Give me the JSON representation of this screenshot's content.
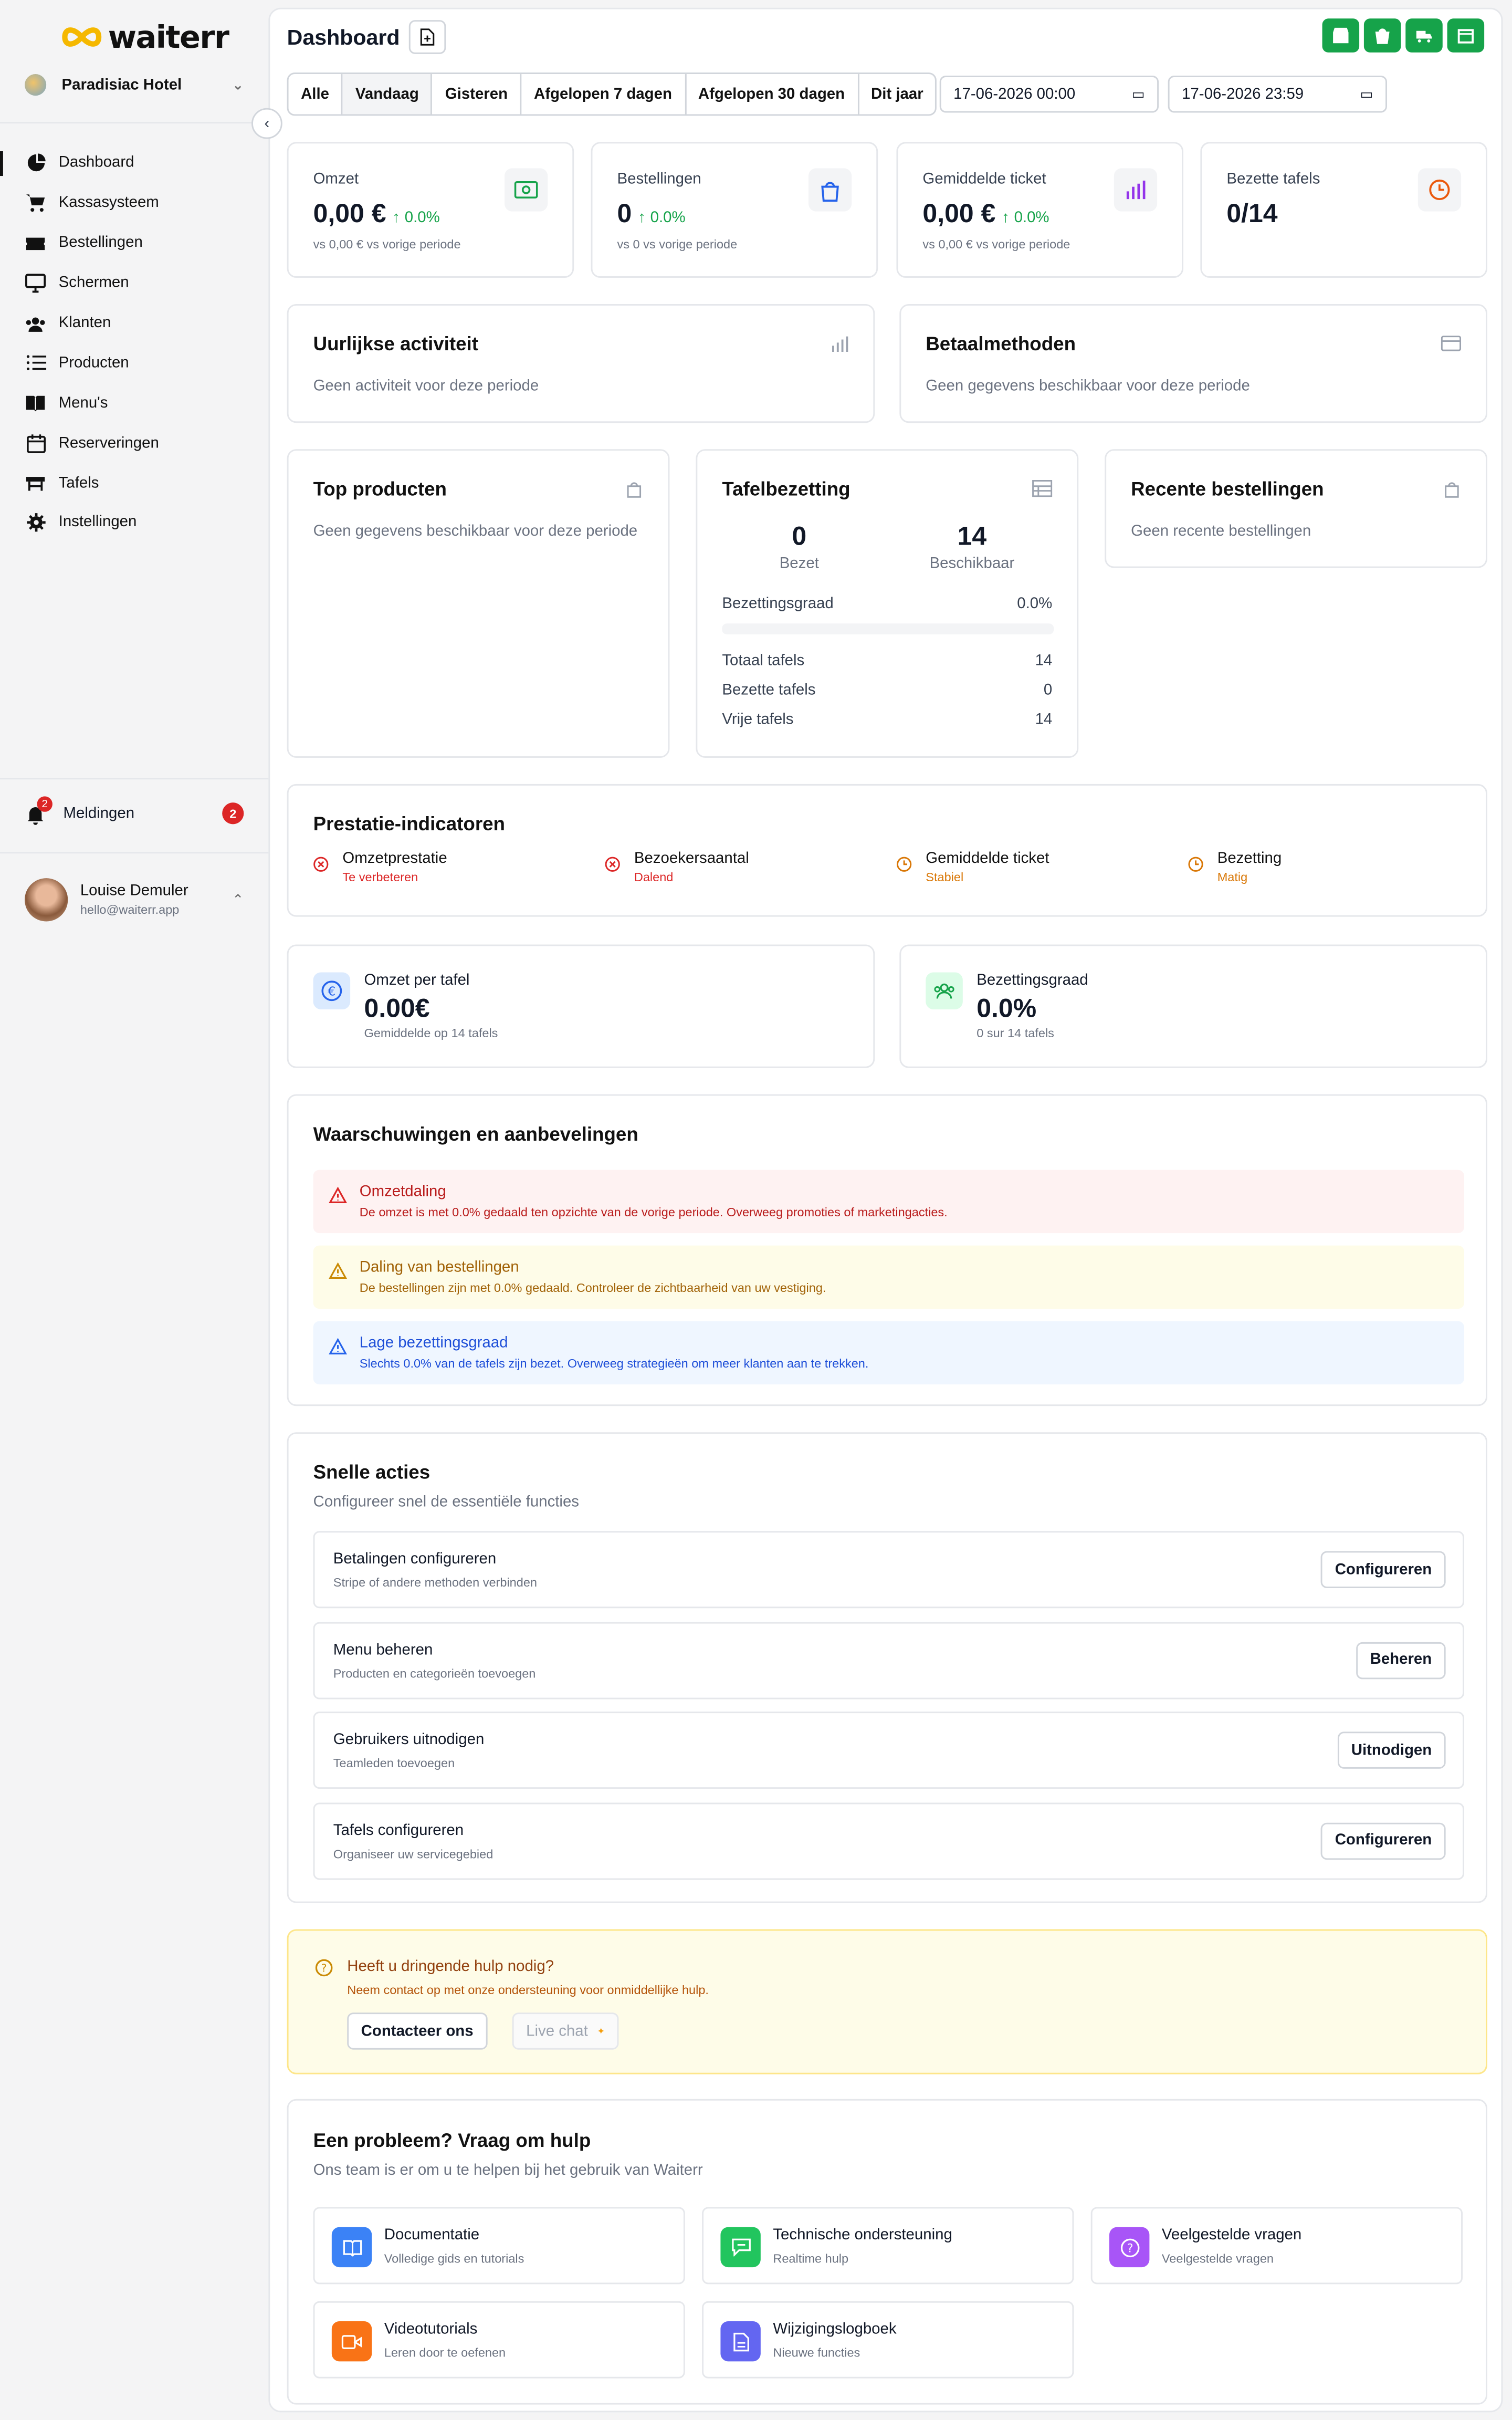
{
  "app": {
    "logo_text": "waiterr",
    "hotel": "Paradisiac Hotel"
  },
  "sidebar": {
    "items": [
      {
        "label": "Dashboard",
        "icon": "pie-chart-icon",
        "active": true
      },
      {
        "label": "Kassasysteem",
        "icon": "cart-icon"
      },
      {
        "label": "Bestellingen",
        "icon": "ticket-icon"
      },
      {
        "label": "Schermen",
        "icon": "monitor-icon"
      },
      {
        "label": "Klanten",
        "icon": "users-icon"
      },
      {
        "label": "Producten",
        "icon": "list-icon"
      },
      {
        "label": "Menu's",
        "icon": "book-icon"
      },
      {
        "label": "Reserveringen",
        "icon": "calendar-icon"
      },
      {
        "label": "Tafels",
        "icon": "table-icon"
      },
      {
        "label": "Instellingen",
        "icon": "gear-icon"
      }
    ],
    "notifications": {
      "label": "Meldingen",
      "count": "2"
    },
    "user": {
      "name": "Louise Demuler",
      "email": "hello@waiterr.app"
    }
  },
  "header": {
    "title": "Dashboard",
    "ranges": [
      "Alle",
      "Vandaag",
      "Gisteren",
      "Afgelopen 7 dagen",
      "Afgelopen 30 dagen",
      "Dit jaar"
    ],
    "selected_range": "Vandaag",
    "date_from": "17-06-2026 00:00",
    "date_to": "17-06-2026 23:59"
  },
  "stats": [
    {
      "label": "Omzet",
      "value": "0,00 €",
      "change": "0.0%",
      "sub": "vs 0,00 € vs vorige periode",
      "icon": "money-icon",
      "icon_color": "#16a34a"
    },
    {
      "label": "Bestellingen",
      "value": "0",
      "change": "0.0%",
      "sub": "vs 0 vs vorige periode",
      "icon": "bag-icon",
      "icon_color": "#2563eb"
    },
    {
      "label": "Gemiddelde ticket",
      "value": "0,00 €",
      "change": "0.0%",
      "sub": "vs 0,00 € vs vorige periode",
      "icon": "bar-chart-icon",
      "icon_color": "#9333ea"
    },
    {
      "label": "Bezette tafels",
      "value": "0/14",
      "change": "",
      "sub": "",
      "icon": "clock-icon",
      "icon_color": "#ea580c"
    }
  ],
  "hourly": {
    "title": "Uurlijkse activiteit",
    "empty": "Geen activiteit voor deze periode"
  },
  "payments": {
    "title": "Betaalmethoden",
    "empty": "Geen gegevens beschikbaar voor deze periode"
  },
  "top_products": {
    "title": "Top producten",
    "empty": "Geen gegevens beschikbaar voor deze periode"
  },
  "occupancy": {
    "title": "Tafelbezetting",
    "occupied": "0",
    "occupied_label": "Bezet",
    "available": "14",
    "available_label": "Beschikbaar",
    "rate_label": "Bezettingsgraad",
    "rate": "0.0%",
    "rate_fraction": 0,
    "rows": [
      {
        "k": "Totaal tafels",
        "v": "14"
      },
      {
        "k": "Bezette tafels",
        "v": "0"
      },
      {
        "k": "Vrije tafels",
        "v": "14"
      }
    ]
  },
  "recent": {
    "title": "Recente bestellingen",
    "empty": "Geen recente bestellingen"
  },
  "kpis": {
    "title": "Prestatie-indicatoren",
    "items": [
      {
        "title": "Omzetprestatie",
        "status": "Te verbeteren",
        "color": "#dc2626",
        "icon": "x-circle-icon"
      },
      {
        "title": "Bezoekersaantal",
        "status": "Dalend",
        "color": "#dc2626",
        "icon": "x-circle-icon"
      },
      {
        "title": "Gemiddelde ticket",
        "status": "Stabiel",
        "color": "#d97706",
        "icon": "clock-icon"
      },
      {
        "title": "Bezetting",
        "status": "Matig",
        "color": "#d97706",
        "icon": "clock-icon"
      }
    ]
  },
  "per_table": {
    "title": "Omzet per tafel",
    "value": "0.00€",
    "sub": "Gemiddelde op 14 tafels",
    "icon": "euro-icon"
  },
  "occ_rate": {
    "title": "Bezettingsgraad",
    "value": "0.0%",
    "sub": "0 sur 14 tafels",
    "icon": "group-icon"
  },
  "warnings": {
    "title": "Waarschuwingen en aanbevelingen",
    "items": [
      {
        "title": "Omzetdaling",
        "desc": "De omzet is met 0.0% gedaald ten opzichte van de vorige periode. Overweeg promoties of marketingacties.",
        "bg": "#fef2f2",
        "color": "#b91c1c",
        "icon_color": "#dc2626"
      },
      {
        "title": "Daling van bestellingen",
        "desc": "De bestellingen zijn met 0.0% gedaald. Controleer de zichtbaarheid van uw vestiging.",
        "bg": "#fefce8",
        "color": "#a16207",
        "icon_color": "#ca8a04"
      },
      {
        "title": "Lage bezettingsgraad",
        "desc": "Slechts 0.0% van de tafels zijn bezet. Overweeg strategieën om meer klanten aan te trekken.",
        "bg": "#eff6ff",
        "color": "#1d4ed8",
        "icon_color": "#2563eb"
      }
    ]
  },
  "quick": {
    "title": "Snelle acties",
    "subtitle": "Configureer snel de essentiële functies",
    "items": [
      {
        "title": "Betalingen configureren",
        "desc": "Stripe of andere methoden verbinden",
        "button": "Configureren"
      },
      {
        "title": "Menu beheren",
        "desc": "Producten en categorieën toevoegen",
        "button": "Beheren"
      },
      {
        "title": "Gebruikers uitnodigen",
        "desc": "Teamleden toevoegen",
        "button": "Uitnodigen"
      },
      {
        "title": "Tafels configureren",
        "desc": "Organiseer uw servicegebied",
        "button": "Configureren"
      }
    ]
  },
  "urgent": {
    "title": "Heeft u dringende hulp nodig?",
    "desc": "Neem contact op met onze ondersteuning voor onmiddellijke hulp.",
    "contact": "Contacteer ons",
    "chat": "Live chat"
  },
  "help": {
    "title": "Een probleem? Vraag om hulp",
    "subtitle": "Ons team is er om u te helpen bij het gebruik van Waiterr",
    "items": [
      {
        "title": "Documentatie",
        "desc": "Volledige gids en tutorials",
        "color": "#3b82f6",
        "icon": "book-icon"
      },
      {
        "title": "Technische ondersteuning",
        "desc": "Realtime hulp",
        "color": "#22c55e",
        "icon": "chat-icon"
      },
      {
        "title": "Veelgestelde vragen",
        "desc": "Veelgestelde vragen",
        "color": "#a855f7",
        "icon": "question-icon"
      },
      {
        "title": "Videotutorials",
        "desc": "Leren door te oefenen",
        "color": "#f97316",
        "icon": "video-icon"
      },
      {
        "title": "Wijzigingslogboek",
        "desc": "Nieuwe functies",
        "color": "#6366f1",
        "icon": "file-icon"
      }
    ]
  }
}
